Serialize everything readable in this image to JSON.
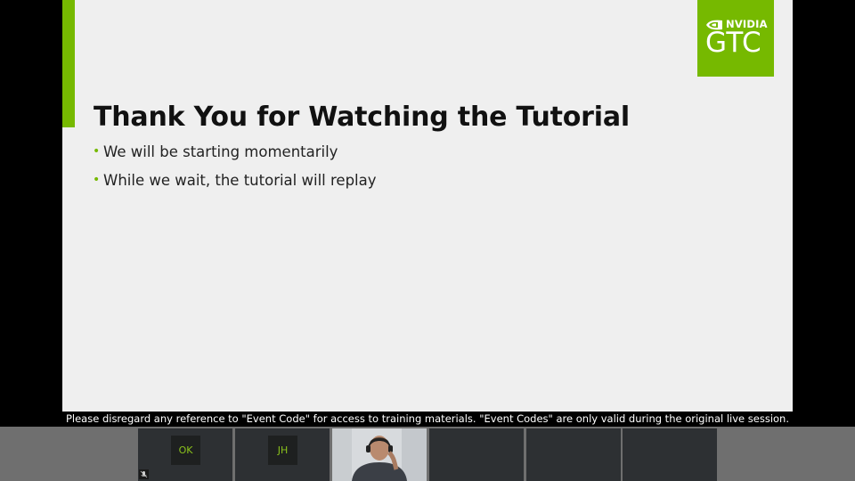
{
  "slide": {
    "title": "Thank You for Watching the Tutorial",
    "bullets": [
      "We will be starting momentarily",
      "While we wait, the tutorial will replay"
    ],
    "logo": {
      "brand": "NVIDIA",
      "event": "GTC"
    }
  },
  "caption": "Please disregard any reference to \"Event Code\" for access to training materials. \"Event Codes\" are only valid during the original live session.",
  "participants": [
    {
      "initials": "OK",
      "type": "avatar"
    },
    {
      "initials": "JH",
      "type": "avatar"
    },
    {
      "type": "video"
    },
    {
      "type": "empty"
    },
    {
      "type": "empty"
    },
    {
      "type": "empty"
    }
  ],
  "colors": {
    "accent": "#76b900",
    "slide_background": "#efefef",
    "avatar_text": "#8bc21c"
  },
  "icons": {
    "logo_mark": "nvidia-eye-icon",
    "mic": "mic-muted-icon"
  }
}
